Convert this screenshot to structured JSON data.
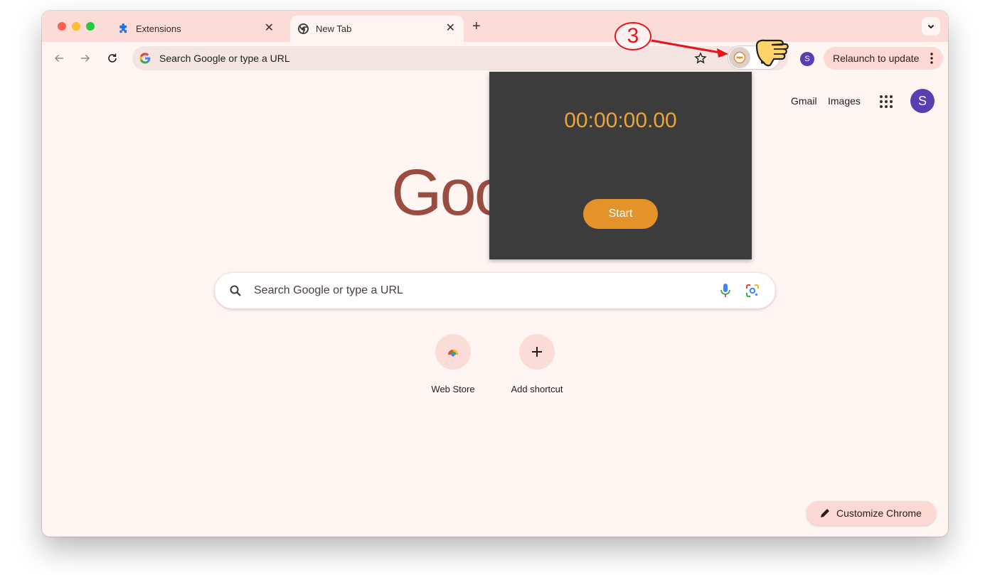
{
  "browser": {
    "tabs": [
      {
        "title": "Extensions"
      },
      {
        "title": "New Tab"
      }
    ],
    "omnibox": {
      "placeholder": "Search Google or type a URL"
    },
    "profile_initial": "S",
    "relaunch_label": "Relaunch to update"
  },
  "ntp": {
    "links": {
      "gmail": "Gmail",
      "images": "Images"
    },
    "avatar_initial": "S",
    "logo_text": "Goo",
    "search_placeholder": "Search Google or type a URL",
    "shortcuts": [
      {
        "label": "Web Store"
      },
      {
        "label": "Add shortcut"
      }
    ],
    "customize_label": "Customize Chrome"
  },
  "popup": {
    "timer": "00:00:00.00",
    "start_label": "Start"
  },
  "annotation": {
    "step_number": "3",
    "color": "#e8141a"
  },
  "colors": {
    "titlebar": "#fcdcd8",
    "page_bg": "#fff5f3",
    "accent_purple": "#5a3db0",
    "popup_bg": "#3c3c3c",
    "timer_color": "#e9a43a",
    "start_button": "#e4922a"
  }
}
